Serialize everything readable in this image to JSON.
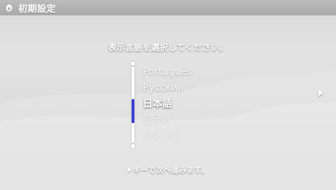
{
  "header": {
    "title": "初期設定",
    "icon": "psp-egg-icon"
  },
  "prompt": "表示言語を選択してください。",
  "languages": [
    {
      "label": "Português",
      "opacity": 0.85
    },
    {
      "label": "Русский",
      "opacity": 0.85
    },
    {
      "label": "日本語",
      "opacity": 1.0
    },
    {
      "label": "한국어",
      "opacity": 0.55
    },
    {
      "label": "简体中文",
      "opacity": 0.3
    }
  ],
  "selected_language": "日本語",
  "scrollbar": {
    "position": 0.62
  },
  "hint": {
    "icon": "right-arrow-icon",
    "text": "キーで次へ進みます。"
  },
  "colors": {
    "accent": "#3b3fd4",
    "titlebar": "#a9a9a9",
    "background": "#dcdcdc"
  }
}
